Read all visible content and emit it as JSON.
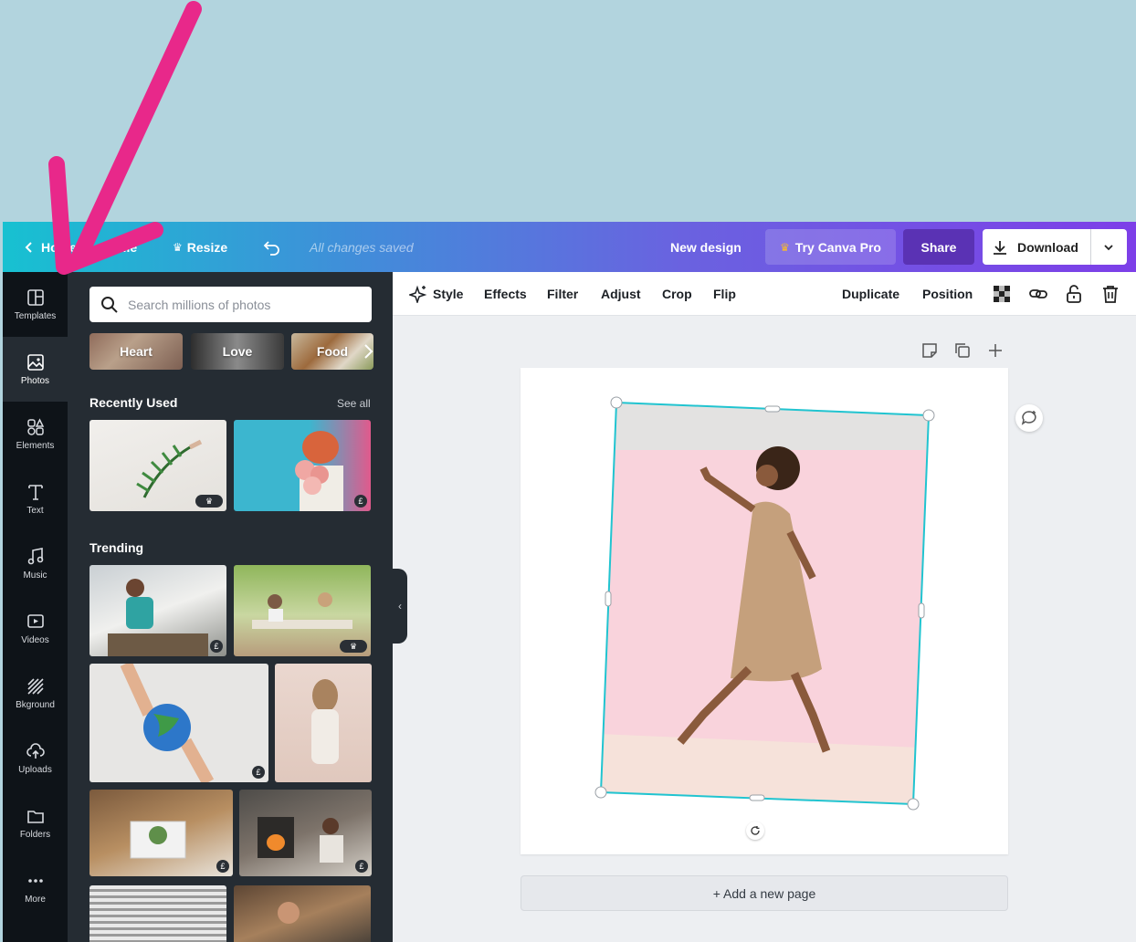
{
  "topbar": {
    "home_label": "Home",
    "file_label": "File",
    "resize_label": "Resize",
    "saved_status": "All changes saved",
    "design_name": "New design",
    "pro_label": "Try Canva Pro",
    "share_label": "Share",
    "download_label": "Download"
  },
  "sidebar": {
    "items": [
      {
        "label": "Templates",
        "icon": "templates-icon"
      },
      {
        "label": "Photos",
        "icon": "photos-icon"
      },
      {
        "label": "Elements",
        "icon": "elements-icon"
      },
      {
        "label": "Text",
        "icon": "text-icon"
      },
      {
        "label": "Music",
        "icon": "music-icon"
      },
      {
        "label": "Videos",
        "icon": "videos-icon"
      },
      {
        "label": "Bkground",
        "icon": "background-icon"
      },
      {
        "label": "Uploads",
        "icon": "uploads-icon"
      },
      {
        "label": "Folders",
        "icon": "folders-icon"
      },
      {
        "label": "More",
        "icon": "more-icon"
      }
    ],
    "active": "Photos"
  },
  "panel": {
    "search_placeholder": "Search millions of photos",
    "chips": [
      "Heart",
      "Love",
      "Food"
    ],
    "recently_used_title": "Recently Used",
    "see_all": "See all",
    "trending_title": "Trending",
    "badges": {
      "pro": "♛",
      "paid": "£"
    }
  },
  "edit_bar": {
    "style": "Style",
    "effects": "Effects",
    "filter": "Filter",
    "adjust": "Adjust",
    "crop": "Crop",
    "flip": "Flip",
    "duplicate": "Duplicate",
    "position": "Position"
  },
  "canvas": {
    "add_page": "+ Add a new page"
  },
  "colors": {
    "accent": "#21c4d0",
    "share": "#5a32b4",
    "arrow": "#e8288a",
    "canvas_bg": "#b2d4de"
  }
}
